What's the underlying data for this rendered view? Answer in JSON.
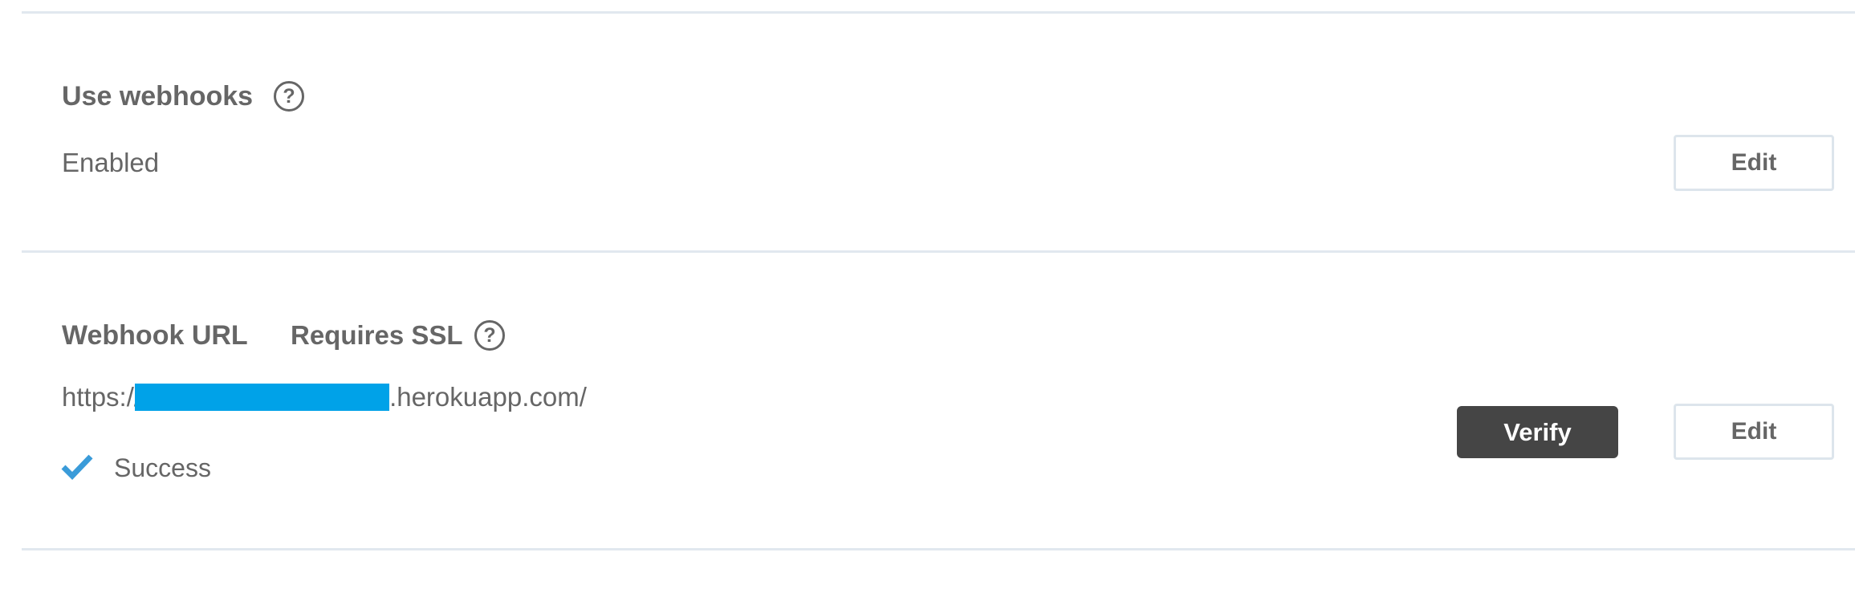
{
  "webhooks_section": {
    "title": "Use webhooks",
    "help_icon": "question-circle-icon",
    "value": "Enabled",
    "edit_label": "Edit"
  },
  "webhook_url_section": {
    "title": "Webhook URL",
    "requirement": "Requires SSL",
    "help_icon": "question-circle-icon",
    "url_prefix": "https://",
    "url_suffix": ".herokuapp.com/",
    "redaction_color": "#00a2e8",
    "status_icon": "checkmark-icon",
    "status_text": "Success",
    "verify_label": "Verify",
    "edit_label": "Edit"
  },
  "colors": {
    "text": "#666666",
    "divider": "#e1e8ef",
    "verify_bg": "#454545",
    "check": "#3a9bd9"
  }
}
